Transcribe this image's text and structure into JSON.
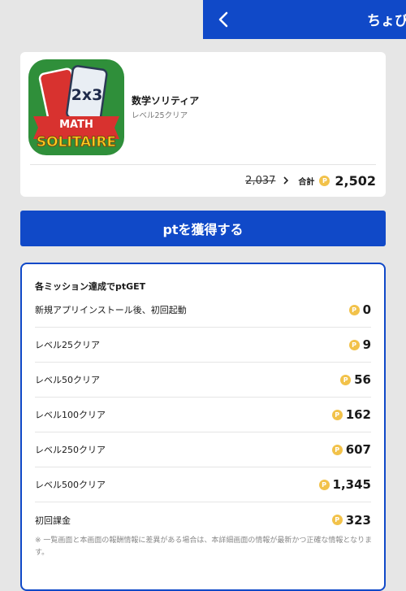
{
  "header": {
    "title": "ちょびリッチ"
  },
  "app": {
    "name": "数学ソリティア",
    "subtitle": "レベル25クリア",
    "icon_text": {
      "top": "2x3",
      "middle": "MATH",
      "bottom": "SOLITAIRE"
    },
    "old_price": "2,037",
    "total_label": "合計",
    "coin_symbol": "P",
    "total_value": "2,502"
  },
  "cta": {
    "label": "ptを獲得する"
  },
  "missions": {
    "title": "各ミッション達成でptGET",
    "items": [
      {
        "label": "新規アプリインストール後、初回起動",
        "points": "0"
      },
      {
        "label": "レベル25クリア",
        "points": "9"
      },
      {
        "label": "レベル50クリア",
        "points": "56"
      },
      {
        "label": "レベル100クリア",
        "points": "162"
      },
      {
        "label": "レベル250クリア",
        "points": "607"
      },
      {
        "label": "レベル500クリア",
        "points": "1,345"
      },
      {
        "label": "初回課金",
        "points": "323"
      }
    ],
    "note": "※ 一覧画面と本画面の報酬情報に差異がある場合は、本詳細画面の情報が最新かつ正確な情報となります。"
  },
  "colors": {
    "brand_blue": "#1049c8",
    "coin_gold": "#f2c24a",
    "icon_green": "#2f8f3a",
    "icon_red": "#d8322f",
    "icon_yellow": "#ffd21f"
  }
}
